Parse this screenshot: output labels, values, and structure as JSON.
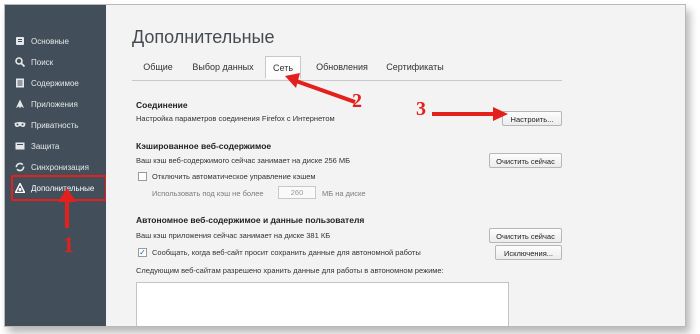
{
  "sidebar": {
    "items": [
      {
        "label": "Основные",
        "icon": "main-icon"
      },
      {
        "label": "Поиск",
        "icon": "search-icon"
      },
      {
        "label": "Содержимое",
        "icon": "content-icon"
      },
      {
        "label": "Приложения",
        "icon": "applications-icon"
      },
      {
        "label": "Приватность",
        "icon": "privacy-mask-icon"
      },
      {
        "label": "Защита",
        "icon": "security-icon"
      },
      {
        "label": "Синхронизация",
        "icon": "sync-icon"
      },
      {
        "label": "Дополнительные",
        "icon": "advanced-icon"
      }
    ]
  },
  "page": {
    "title": "Дополнительные"
  },
  "tabs": [
    "Общие",
    "Выбор данных",
    "Сеть",
    "Обновления",
    "Сертификаты"
  ],
  "connection": {
    "heading": "Соединение",
    "description": "Настройка параметров соединения Firefox с Интернетом",
    "configure_button": "Настроить..."
  },
  "cache": {
    "heading": "Кэшированное веб-содержимое",
    "status": "Ваш кэш веб-содержимого сейчас занимает на диске 256 МБ",
    "clear_button": "Очистить сейчас",
    "override_label": "Отключить автоматическое управление кэшем",
    "limit_prefix": "Использовать под кэш не более",
    "limit_value": "260",
    "limit_suffix": "МБ на диске"
  },
  "offline": {
    "heading": "Автономное веб-содержимое и данные пользователя",
    "status": "Ваш кэш приложения сейчас занимает на диске 381 КБ",
    "clear_button": "Очистить сейчас",
    "notify_label": "Сообщать, когда веб-сайт просит сохранить данные для автономной работы",
    "exceptions_button": "Исключения...",
    "allowed_sites_label": "Следующим веб-сайтам разрешено хранить данные для работы в автономном режиме:"
  },
  "annotations": [
    "1",
    "2",
    "3"
  ],
  "colors": {
    "sidebar": "#424f5a",
    "annotation": "#e3201c",
    "content_bg": "#f3f3f3"
  }
}
